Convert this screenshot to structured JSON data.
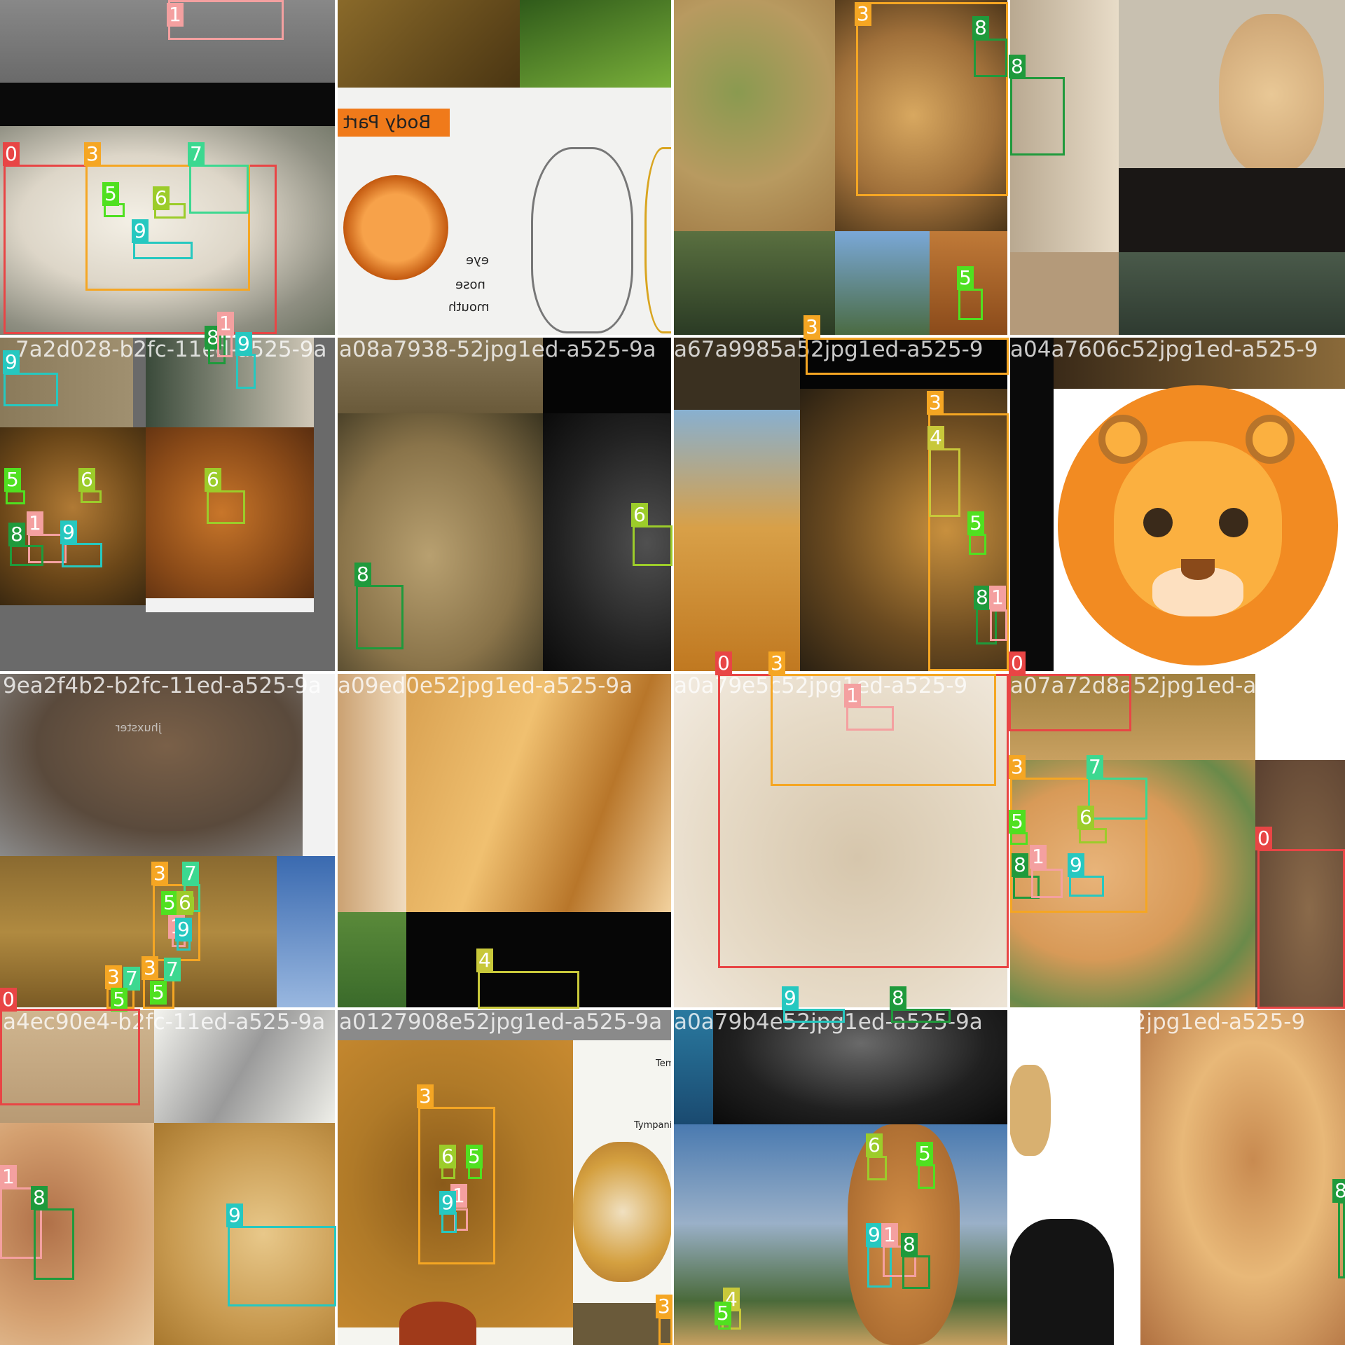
{
  "classes": {
    "0": {
      "color": "#e84545"
    },
    "1": {
      "color": "#f4a0a0"
    },
    "3": {
      "color": "#f5a623"
    },
    "4": {
      "color": "#c8c83a"
    },
    "5": {
      "color": "#50e020"
    },
    "6": {
      "color": "#9ccc2a"
    },
    "7": {
      "color": "#3cd890"
    },
    "8": {
      "color": "#1f9a3c"
    },
    "9": {
      "color": "#26c8c0"
    }
  },
  "tiles": [
    {
      "id": "r0c0",
      "filename": "",
      "bg": [
        "#6e6e6e",
        "#dcdcd2",
        "#8c8c80"
      ]
    },
    {
      "id": "r0c1",
      "filename": "",
      "bg": [
        "#6b4a1e",
        "#f2f2f0",
        "#e8eee4"
      ],
      "texts": [
        "Body Part",
        "eye",
        "nose",
        "mouth"
      ]
    },
    {
      "id": "r0c2",
      "filename": "",
      "bg": [
        "#a08a50",
        "#c69a55",
        "#7090b0"
      ]
    },
    {
      "id": "r0c3",
      "filename": "",
      "bg": [
        "#c8b8a0",
        "#2a2522",
        "#e0c090"
      ]
    },
    {
      "id": "r1c0",
      "filename": "7a2d028-b2fc-11ed-a525-9a",
      "bg": [
        "#6a6a6a",
        "#8a5a24",
        "#b06a28"
      ]
    },
    {
      "id": "r1c1",
      "filename": "a08a7938-52jpg1ed-a525-9a",
      "bg": [
        "#9a8a5e",
        "#2a2a2a",
        "#141414"
      ]
    },
    {
      "id": "r1c2",
      "filename": "a67a9985a52jpg1ed-a525-9",
      "bg": [
        "#e0b060",
        "#4a3a20",
        "#b07a30"
      ]
    },
    {
      "id": "r1c3",
      "filename": "a04a7606c52jpg1ed-a525-9",
      "bg": [
        "#ffffff",
        "#f5922a",
        "#fdbf5a"
      ]
    },
    {
      "id": "r2c0",
      "filename": "9ea2f4b2-b2fc-11ed-a525-9a",
      "bg": [
        "#6a5a44",
        "#9a7a3a",
        "#3a6ab0"
      ],
      "texts": [
        "jhuxster"
      ]
    },
    {
      "id": "r2c1",
      "filename": "a09ed0e52jpg1ed-a525-9a",
      "bg": [
        "#e0b070",
        "#c8862a",
        "#0a0a0a"
      ]
    },
    {
      "id": "r2c2",
      "filename": "a0a79e5c52jpg1ed-a525-9",
      "bg": [
        "#efe6d8",
        "#d6c6ac",
        "#a89476"
      ]
    },
    {
      "id": "r2c3",
      "filename": "a07a72d8a52jpg1ed-a525-98",
      "bg": [
        "#c8a070",
        "#d89050",
        "#6a5030"
      ]
    },
    {
      "id": "r3c0",
      "filename": "a4ec90e4-b2fc-11ed-a525-9a",
      "bg": [
        "#c8aa80",
        "#c89060",
        "#f5f5f0"
      ]
    },
    {
      "id": "r3c1",
      "filename": "a0127908e52jpg1ed-a525-9a",
      "bg": [
        "#9a6a20",
        "#f5f5f0",
        "#b07428"
      ],
      "texts": [
        "Tempo",
        "Tympanic bulla"
      ]
    },
    {
      "id": "r3c2",
      "filename": "a0a79b4e52jpg1ed-a525-9a",
      "bg": [
        "#202020",
        "#4a7ab0",
        "#c08a40"
      ]
    },
    {
      "id": "r3c3",
      "filename": "a0a79a5e52jpg1ed-a525-9",
      "bg": [
        "#ffffff",
        "#e0b070",
        "#a06030"
      ]
    }
  ]
}
